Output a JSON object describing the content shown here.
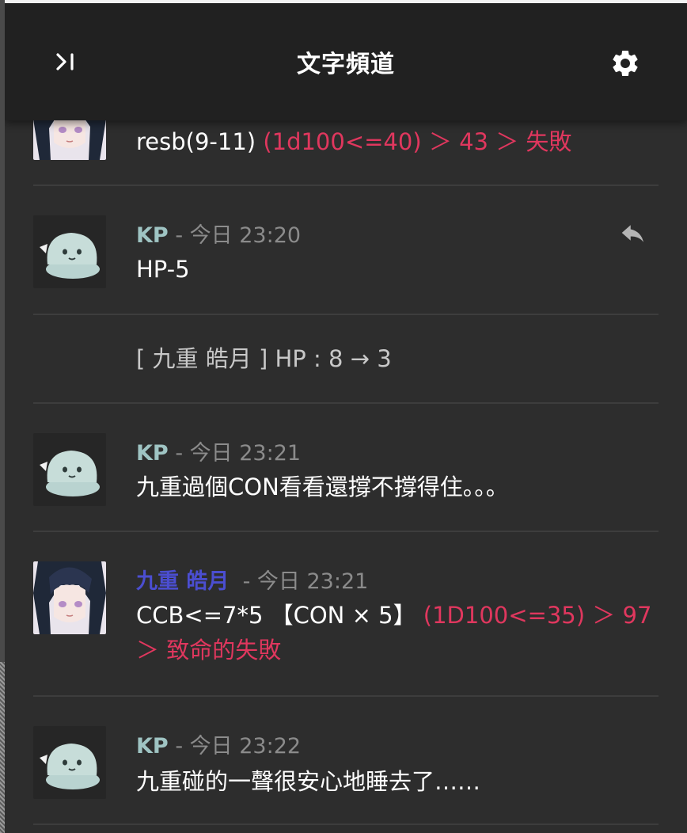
{
  "header": {
    "title": "文字頻道",
    "collapse_icon": "collapse-panel-icon",
    "settings_icon": "gear-icon"
  },
  "messages": [
    {
      "author": "",
      "avatar": "character-avatar",
      "text": "resb(9-11)",
      "roll": "(1d100<=40) ＞ 43 ＞ 失敗"
    },
    {
      "author": "KP",
      "separator": "-",
      "time": "今日 23:20",
      "avatar": "kp-slime-avatar",
      "text": "HP-5",
      "reply_icon": "reply-icon"
    },
    {
      "system_text": "[ 九重 皓月  ] HP : 8 → 3"
    },
    {
      "author": "KP",
      "separator": "-",
      "time": "今日 23:21",
      "avatar": "kp-slime-avatar",
      "text": "九重過個CON看看還撐不撐得住。。。"
    },
    {
      "author": "九重 皓月",
      "separator": "-",
      "time": "今日 23:21",
      "avatar": "character-avatar",
      "text": "CCB<=7*5 【CON × 5】",
      "roll": "(1D100<=35) ＞ 97",
      "roll_line2": "＞ 致命的失敗"
    },
    {
      "author": "KP",
      "separator": "-",
      "time": "今日 23:22",
      "avatar": "kp-slime-avatar",
      "text": "九重碰的一聲很安心地睡去了……"
    }
  ],
  "colors": {
    "panel_bg": "#2d2d2d",
    "header_bg": "#212121",
    "kp_name": "#9fc4c3",
    "character_name": "#4b4ed1",
    "roll_text": "#e0375e",
    "timestamp": "#8b8b8b"
  }
}
